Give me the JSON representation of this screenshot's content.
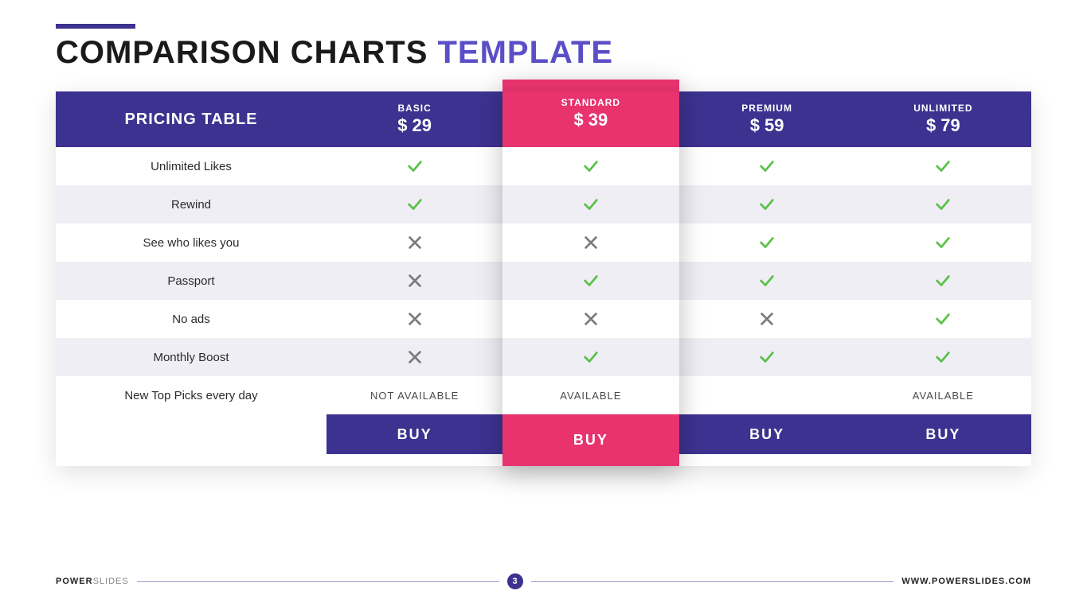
{
  "title_a": "COMPARISON CHARTS ",
  "title_b": "TEMPLATE",
  "header_label": "PRICING TABLE",
  "features": [
    "Unlimited Likes",
    "Rewind",
    "See who likes you",
    "Passport",
    "No ads",
    "Monthly Boost",
    "New Top Picks every day"
  ],
  "plans": [
    {
      "name": "BASIC",
      "price": "$ 29",
      "featured": false,
      "values": [
        "check",
        "check",
        "cross",
        "cross",
        "cross",
        "cross",
        "NOT AVAILABLE"
      ],
      "cta": "BUY"
    },
    {
      "name": "STANDARD",
      "price": "$ 39",
      "featured": true,
      "values": [
        "check",
        "check",
        "cross",
        "check",
        "cross",
        "check",
        "AVAILABLE"
      ],
      "cta": "BUY"
    },
    {
      "name": "PREMIUM",
      "price": "$ 59",
      "featured": false,
      "values": [
        "check",
        "check",
        "check",
        "check",
        "cross",
        "check",
        ""
      ],
      "cta": "BUY"
    },
    {
      "name": "UNLIMITED",
      "price": "$ 79",
      "featured": false,
      "values": [
        "check",
        "check",
        "check",
        "check",
        "check",
        "check",
        "AVAILABLE"
      ],
      "cta": "BUY"
    }
  ],
  "footer": {
    "brand_bold": "POWER",
    "brand_light": "SLIDES",
    "page": "3",
    "url": "WWW.POWERSLIDES.COM"
  },
  "chart_data": {
    "type": "table",
    "title": "PRICING TABLE",
    "columns": [
      "BASIC",
      "STANDARD",
      "PREMIUM",
      "UNLIMITED"
    ],
    "prices": [
      29,
      39,
      59,
      79
    ],
    "rows": [
      "Unlimited Likes",
      "Rewind",
      "See who likes you",
      "Passport",
      "No ads",
      "Monthly Boost",
      "New Top Picks every day"
    ],
    "matrix": [
      [
        true,
        true,
        true,
        true
      ],
      [
        true,
        true,
        true,
        true
      ],
      [
        false,
        false,
        true,
        true
      ],
      [
        false,
        true,
        true,
        true
      ],
      [
        false,
        false,
        false,
        true
      ],
      [
        false,
        true,
        true,
        true
      ],
      [
        "NOT AVAILABLE",
        "AVAILABLE",
        "",
        "AVAILABLE"
      ]
    ]
  }
}
